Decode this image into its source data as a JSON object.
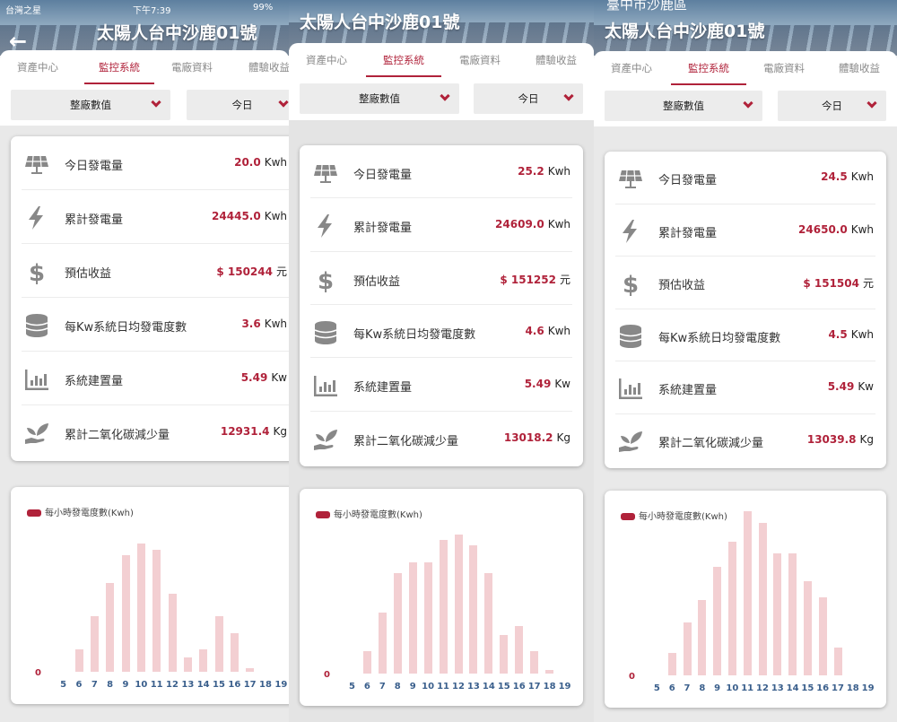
{
  "accent_color": "#b0223a",
  "statusbar": {
    "carrier": "台灣之星",
    "time": "下午7:39",
    "battery": "99%"
  },
  "screens": [
    {
      "title": "太陽人台中沙鹿01號",
      "subtitle": "",
      "tabs": [
        "資產中心",
        "監控系統",
        "電廠資料",
        "體驗收益"
      ],
      "active_tab": 1,
      "dropdowns": [
        "整廠數值",
        "今日"
      ],
      "metrics": [
        {
          "icon": "solar-panel-icon",
          "label": "今日發電量",
          "value": "20.0",
          "unit": "Kwh"
        },
        {
          "icon": "lightning-icon",
          "label": "累計發電量",
          "value": "24445.0",
          "unit": "Kwh"
        },
        {
          "icon": "dollar-icon",
          "label": "預估收益",
          "value": "$ 150244",
          "unit": "元"
        },
        {
          "icon": "database-icon",
          "label": "每Kw系統日均發電度數",
          "value": "3.6",
          "unit": "Kwh"
        },
        {
          "icon": "bar-chart-icon",
          "label": "系統建置量",
          "value": "5.49",
          "unit": "Kw"
        },
        {
          "icon": "plant-hand-icon",
          "label": "累計二氧化碳減少量",
          "value": "12931.4",
          "unit": "Kg"
        }
      ],
      "chart_data": {
        "type": "bar",
        "legend": "每小時發電度數(Kwh)",
        "y_tick_label": "0",
        "categories": [
          "5",
          "6",
          "7",
          "8",
          "9",
          "10",
          "11",
          "12",
          "13",
          "14",
          "15",
          "16",
          "17",
          "18",
          "19"
        ],
        "values": [
          0,
          0.4,
          1.0,
          1.6,
          2.1,
          2.3,
          2.2,
          1.4,
          0.26,
          0.4,
          1.0,
          0.7,
          0.06,
          0,
          0
        ]
      }
    },
    {
      "title": "太陽人台中沙鹿01號",
      "subtitle": "",
      "tabs": [
        "資產中心",
        "監控系統",
        "電廠資料",
        "體驗收益"
      ],
      "active_tab": 1,
      "dropdowns": [
        "整廠數值",
        "今日"
      ],
      "metrics": [
        {
          "icon": "solar-panel-icon",
          "label": "今日發電量",
          "value": "25.2",
          "unit": "Kwh"
        },
        {
          "icon": "lightning-icon",
          "label": "累計發電量",
          "value": "24609.0",
          "unit": "Kwh"
        },
        {
          "icon": "dollar-icon",
          "label": "預估收益",
          "value": "$ 151252",
          "unit": "元"
        },
        {
          "icon": "database-icon",
          "label": "每Kw系統日均發電度數",
          "value": "4.6",
          "unit": "Kwh"
        },
        {
          "icon": "bar-chart-icon",
          "label": "系統建置量",
          "value": "5.49",
          "unit": "Kw"
        },
        {
          "icon": "plant-hand-icon",
          "label": "累計二氧化碳減少量",
          "value": "13018.2",
          "unit": "Kg"
        }
      ],
      "chart_data": {
        "type": "bar",
        "legend": "每小時發電度數(Kwh)",
        "y_tick_label": "0",
        "categories": [
          "5",
          "6",
          "7",
          "8",
          "9",
          "10",
          "11",
          "12",
          "13",
          "14",
          "15",
          "16",
          "17",
          "18",
          "19"
        ],
        "values": [
          0,
          0.4,
          1.1,
          1.8,
          2.0,
          2.0,
          2.4,
          2.5,
          2.3,
          1.8,
          0.7,
          0.85,
          0.4,
          0.06,
          0
        ]
      }
    },
    {
      "title": "太陽人台中沙鹿01號",
      "subtitle": "臺中市沙鹿區",
      "tabs": [
        "資產中心",
        "監控系統",
        "電廠資料",
        "體驗收益"
      ],
      "active_tab": 1,
      "dropdowns": [
        "整廠數值",
        "今日"
      ],
      "metrics": [
        {
          "icon": "solar-panel-icon",
          "label": "今日發電量",
          "value": "24.5",
          "unit": "Kwh"
        },
        {
          "icon": "lightning-icon",
          "label": "累計發電量",
          "value": "24650.0",
          "unit": "Kwh"
        },
        {
          "icon": "dollar-icon",
          "label": "預估收益",
          "value": "$ 151504",
          "unit": "元"
        },
        {
          "icon": "database-icon",
          "label": "每Kw系統日均發電度數",
          "value": "4.5",
          "unit": "Kwh"
        },
        {
          "icon": "bar-chart-icon",
          "label": "系統建置量",
          "value": "5.49",
          "unit": "Kw"
        },
        {
          "icon": "plant-hand-icon",
          "label": "累計二氧化碳減少量",
          "value": "13039.8",
          "unit": "Kg"
        }
      ],
      "chart_data": {
        "type": "bar",
        "legend": "每小時發電度數(Kwh)",
        "y_tick_label": "0",
        "categories": [
          "5",
          "6",
          "7",
          "8",
          "9",
          "10",
          "11",
          "12",
          "13",
          "14",
          "15",
          "16",
          "17",
          "18",
          "19"
        ],
        "values": [
          0,
          0.4,
          0.95,
          1.35,
          1.95,
          2.4,
          2.95,
          2.75,
          2.2,
          2.2,
          1.7,
          1.4,
          0.5,
          0,
          0
        ]
      }
    }
  ]
}
